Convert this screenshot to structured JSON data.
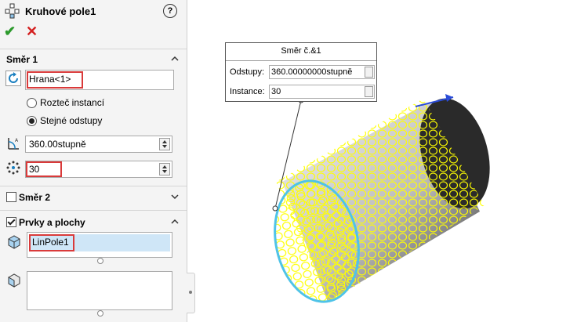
{
  "panel": {
    "title": "Kruhové pole1",
    "help_label": "?",
    "ok_label": "✔",
    "cancel_label": "✕",
    "direction1": {
      "header": "Směr 1",
      "edge_value": "Hrana<1>",
      "radio_spacing_label": "Rozteč instancí",
      "radio_equal_label": "Stejné odstupy",
      "angle_value": "360.00stupně",
      "instances_value": "30"
    },
    "direction2": {
      "header": "Směr 2",
      "checked": false
    },
    "features": {
      "header": "Prvky a plochy",
      "checked": true,
      "selected_item": "LinPole1",
      "faces_list": ""
    }
  },
  "callout": {
    "title": "Směr č.&1",
    "spacing_label": "Odstupy:",
    "spacing_value": "360.00000000stupně",
    "instances_label": "Instance:",
    "instances_value": "30"
  },
  "colors": {
    "ok": "#2c9a2c",
    "cancel": "#d42020",
    "highlight_border": "#d93a3a",
    "selection": "#cfe6f7",
    "preview_yellow": "#ffff00",
    "edge_cyan": "#4fc3e8"
  }
}
